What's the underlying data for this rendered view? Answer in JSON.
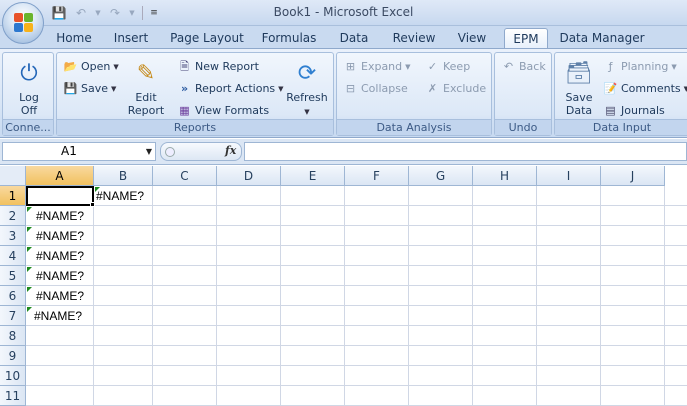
{
  "window": {
    "title": "Book1 - Microsoft Excel"
  },
  "qat": {
    "save_icon": "save-icon",
    "undo_icon": "undo-icon",
    "redo_icon": "redo-icon"
  },
  "tabs": [
    {
      "label": "Home"
    },
    {
      "label": "Insert"
    },
    {
      "label": "Page Layout"
    },
    {
      "label": "Formulas"
    },
    {
      "label": "Data"
    },
    {
      "label": "Review"
    },
    {
      "label": "View"
    },
    {
      "label": "EPM"
    },
    {
      "label": "Data Manager"
    }
  ],
  "active_tab": "EPM",
  "ribbon": {
    "connection": {
      "logoff_label": "Log Off",
      "group_label": "Conne..."
    },
    "reports": {
      "open_label": "Open",
      "save_label": "Save",
      "edit_report_label": "Edit Report",
      "new_report_label": "New Report",
      "report_actions_label": "Report Actions",
      "view_formats_label": "View Formats",
      "refresh_label": "Refresh",
      "group_label": "Reports"
    },
    "data_analysis": {
      "expand_label": "Expand",
      "collapse_label": "Collapse",
      "keep_label": "Keep",
      "exclude_label": "Exclude",
      "group_label": "Data Analysis"
    },
    "undo": {
      "back_label": "Back",
      "group_label": "Undo"
    },
    "data_input": {
      "save_data_label": "Save Data",
      "planning_label": "Planning",
      "comments_label": "Comments",
      "journals_label": "Journals",
      "group_label": "Data Input"
    }
  },
  "formula_bar": {
    "name_box": "A1",
    "fx_label": "fx",
    "formula": ""
  },
  "grid": {
    "columns": [
      "A",
      "B",
      "C",
      "D",
      "E",
      "F",
      "G",
      "H",
      "I",
      "J"
    ],
    "rows": [
      "1",
      "2",
      "3",
      "4",
      "5",
      "6",
      "7",
      "8",
      "9",
      "10",
      "11"
    ],
    "cells": {
      "B1": "#NAME?",
      "A2": "#NAME?",
      "A3": "#NAME?",
      "A4": "#NAME?",
      "A5": "#NAME?",
      "A6": "#NAME?",
      "A7": "#NAME?"
    }
  },
  "colors": {
    "accent": "#1e395b",
    "error_marker": "#1f8a1f",
    "selection_header": "#f1c15f"
  }
}
